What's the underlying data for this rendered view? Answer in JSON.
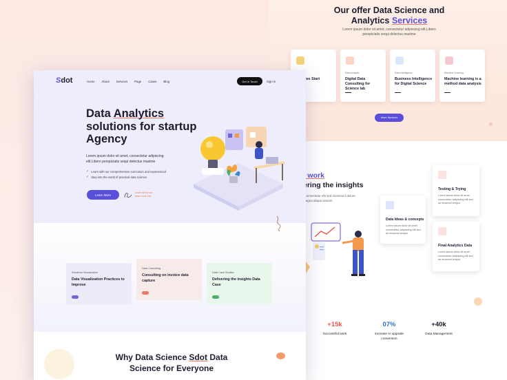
{
  "back_page": {
    "offer": {
      "title_prefix": "Our offer Data Science and Analytics ",
      "title_highlight": "Services",
      "subtitle": "Lorem ipsum dolor sit amet, consectetur adipiscing elit.Libero perspiciatis sequi delectus maxime",
      "services": [
        {
          "category": "",
          "name": "Strategies Start"
        },
        {
          "category": "Data Analytic",
          "name": "Digital Data Consulting for Science lab"
        },
        {
          "category": "Data Intelligence",
          "name": "Business Intelligence for Digital Science"
        },
        {
          "category": "Machine Learning",
          "name": "Machine learning is a method data analysis"
        }
      ],
      "more_button": "More Services"
    },
    "work": {
      "title_line1": "t work",
      "title_line2": "ering the insights",
      "subtitle": "t consectetur elit sed eiusmod t dolore magna aliqua sesiam",
      "cards": [
        {
          "title": "Testing & Trying",
          "desc": "Lorem ipsum dolor sit amet consectetur adipiscing elit sed do eiusmod tempor"
        },
        {
          "title": "Data Ideas & concepts",
          "desc": "Lorem ipsum dolor sit amet consectetur adipiscing elit sed do eiusmod tempor"
        },
        {
          "title": "Final Analytics Data",
          "desc": "Lorem ipsum dolor sit amet consectetur adipiscing elit sed do eiusmod tempor"
        }
      ]
    },
    "stats": [
      {
        "value": "+15k",
        "label": "Successful work",
        "color": "#e8574a"
      },
      {
        "value": "07%",
        "label": "increase in upgrade conversion",
        "color": "#2f6fc5"
      },
      {
        "value": "+40k",
        "label": "Data Management",
        "color": "#1c1c2e"
      }
    ]
  },
  "front_page": {
    "logo": {
      "mark": "S",
      "text": "dot"
    },
    "nav": [
      "Home",
      "About",
      "Services",
      "Page",
      "Cases",
      "Blog"
    ],
    "cta_button": "Get in Touch",
    "signin": "Sign in",
    "hero": {
      "title_a": "Data ",
      "title_b": "Analytics",
      "title_c": " solutions for startup Agency",
      "desc": "Lorem ipsum dolor sit amet, consectetur adipiscing elit.Libero perspiciatis sequi delectus maxime",
      "checks": [
        "Learn with our comprehensive curriculum and experienced",
        "Step into the world of practical data science."
      ],
      "learn_button": "Learn More",
      "note": "Learn About our team work this"
    },
    "feature_cards": [
      {
        "category": "Solutions Visualization",
        "title": "Data Visualization Practices to Improve",
        "bg": "#ecebf8",
        "accent": "#6f66d8"
      },
      {
        "category": "Data Consulting",
        "title": "Consulting on invoice data capture",
        "bg": "#f7ebea",
        "accent": "#e8786a"
      },
      {
        "category": "Data Case Studies",
        "title": "Delivering the insights Data Case",
        "bg": "#e9f6ec",
        "accent": "#4cae6c"
      }
    ],
    "why": {
      "a": "Why Data Science ",
      "b": "Sdot",
      "c": " Data Science for Everyone"
    }
  },
  "colors": {
    "primary": "#5a4fd8",
    "accent": "#e87f63",
    "dark": "#1c1c2e"
  }
}
